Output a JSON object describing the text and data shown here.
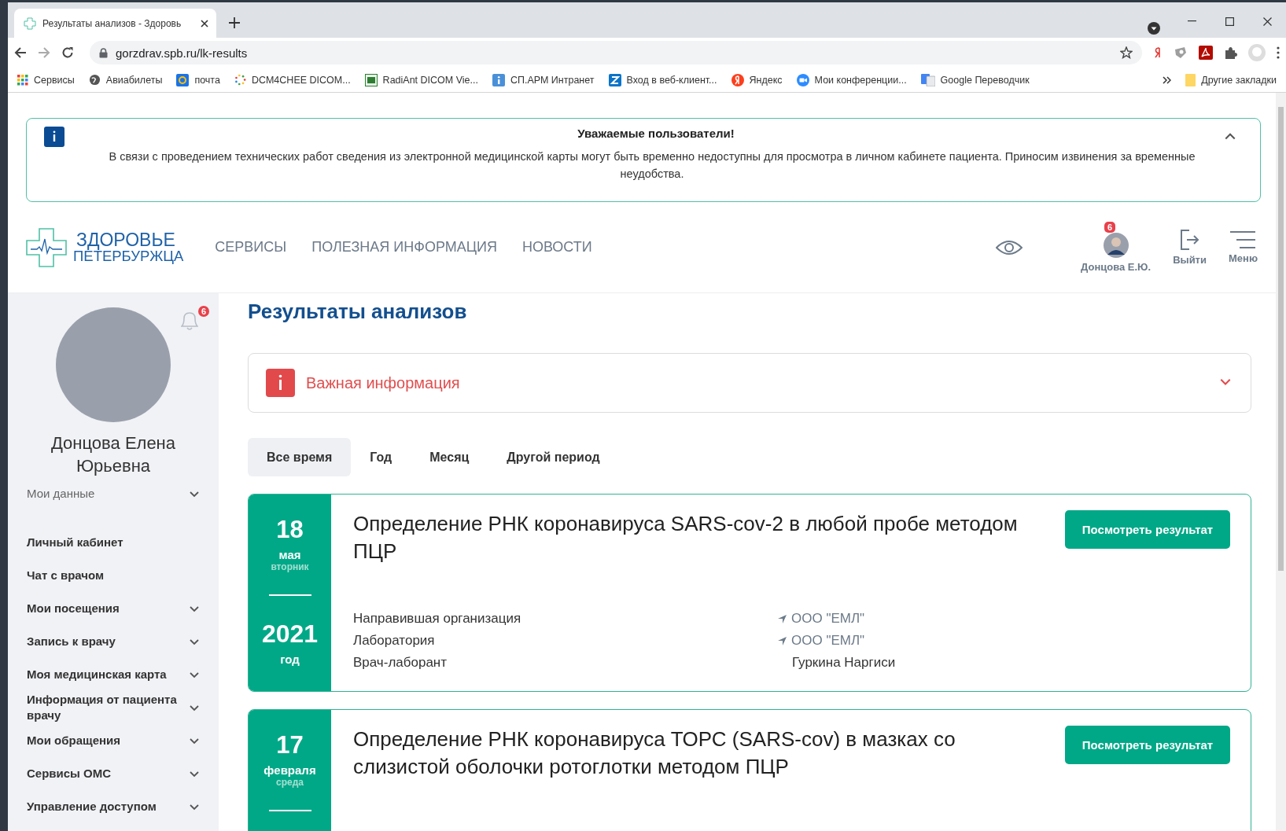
{
  "browser": {
    "tabs": [
      {
        "title": "Результаты анализов - Здоровь",
        "selected": true
      }
    ],
    "url": "gorzdrav.spb.ru/lk-results",
    "bookmarks": [
      {
        "label": "Сервисы"
      },
      {
        "label": "Авиабилеты"
      },
      {
        "label": "почта"
      },
      {
        "label": "DCM4CHEE DICOM..."
      },
      {
        "label": "RadiAnt DICOM Vie..."
      },
      {
        "label": "СП.АРМ Интранет"
      },
      {
        "label": "Вход в веб-клиент..."
      },
      {
        "label": "Яндекс"
      },
      {
        "label": "Мои конференции..."
      },
      {
        "label": "Google Переводчик"
      }
    ],
    "other_bookmarks": "Другие закладки"
  },
  "notice": {
    "title": "Уважаемые пользователи!",
    "text": "В связи с проведением технических работ сведения из электронной медицинской карты могут быть временно недоступны для просмотра в личном кабинете пациента. Приносим извинения за временные неудобства.",
    "expanded": true
  },
  "header": {
    "logo": {
      "line1": "ЗДОРОВЬЕ",
      "line2": "ПЕТЕРБУРЖЦА"
    },
    "nav": [
      "СЕРВИСЫ",
      "ПОЛЕЗНАЯ ИНФОРМАЦИЯ",
      "НОВОСТИ"
    ],
    "user": {
      "name": "Донцова Е.Ю.",
      "badge": "6"
    },
    "logout": "Выйти",
    "menu": "Меню"
  },
  "sidebar": {
    "notifications": "6",
    "name": "Донцова Елена Юрьевна",
    "items": [
      {
        "label": "Мои данные",
        "kind": "section"
      },
      {
        "label": "Личный кабинет",
        "kind": "link"
      },
      {
        "label": "Чат с врачом",
        "kind": "link"
      },
      {
        "label": "Мои посещения",
        "kind": "group"
      },
      {
        "label": "Запись к врачу",
        "kind": "group"
      },
      {
        "label": "Моя медицинская карта",
        "kind": "group"
      },
      {
        "label": "Информация от пациента врачу",
        "kind": "group"
      },
      {
        "label": "Мои обращения",
        "kind": "group"
      },
      {
        "label": "Сервисы ОМС",
        "kind": "group"
      },
      {
        "label": "Управление доступом",
        "kind": "group"
      }
    ]
  },
  "main": {
    "title": "Результаты анализов",
    "important": {
      "label": "Важная информация",
      "expanded": false
    },
    "periods": [
      {
        "label": "Все время",
        "selected": true
      },
      {
        "label": "Год",
        "selected": false
      },
      {
        "label": "Месяц",
        "selected": false
      },
      {
        "label": "Другой период",
        "selected": false
      }
    ],
    "results": [
      {
        "day": "18",
        "month": "мая",
        "weekday": "вторник",
        "year": "2021",
        "year_label": "год",
        "title": "Определение РНК коронавируса SARS-cov-2 в любой пробе методом ПЦР",
        "button": "Посмотреть результат",
        "details": [
          {
            "label": "Направившая организация",
            "value": "ООО \"ЕМЛ\"",
            "kind": "place"
          },
          {
            "label": "Лаборатория",
            "value": "ООО \"ЕМЛ\"",
            "kind": "place"
          },
          {
            "label": "Врач-лаборант",
            "value": "Гуркина Наргиси",
            "kind": "person"
          }
        ]
      },
      {
        "day": "17",
        "month": "февраля",
        "weekday": "среда",
        "title": "Определение РНК коронавируса ТОРС (SARS-cov) в мазках со слизистой оболочки ротоглотки методом ПЦР",
        "button": "Посмотреть результат"
      }
    ]
  }
}
